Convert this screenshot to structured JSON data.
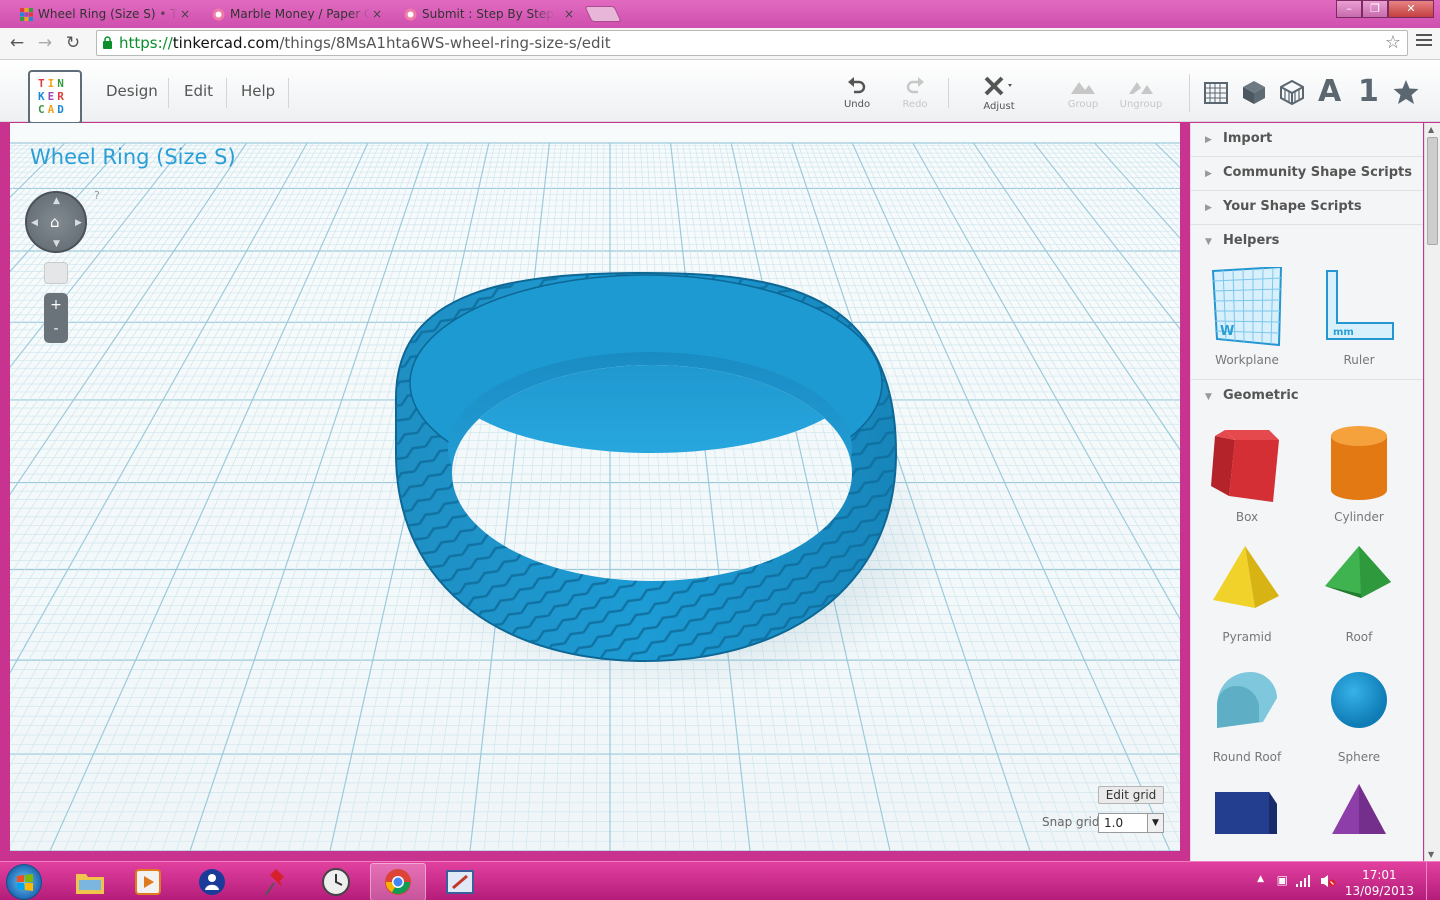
{
  "browser": {
    "tabs": [
      {
        "title": "Wheel Ring (Size S) • Tinkercad",
        "close": "×",
        "active": true
      },
      {
        "title": "Marble Money / Paper Clip",
        "close": "×",
        "active": false
      },
      {
        "title": "Submit : Step By Step",
        "close": "×",
        "active": false
      }
    ],
    "url": {
      "protocol": "https://",
      "host": "tinkercad.com",
      "path": "/things/8MsA1hta6WS-wheel-ring-size-s/edit"
    }
  },
  "header": {
    "logo_rows": [
      [
        "T",
        "I",
        "N"
      ],
      [
        "K",
        "E",
        "R"
      ],
      [
        "C",
        "A",
        "D"
      ]
    ],
    "menu": [
      "Design",
      "Edit",
      "Help"
    ],
    "tools": {
      "undo": "Undo",
      "redo": "Redo",
      "adjust": "Adjust",
      "group": "Group",
      "ungroup": "Ungroup"
    },
    "view_text_label": "A",
    "view_number_label": "1"
  },
  "workspace": {
    "design_title": "Wheel Ring (Size S)",
    "help": "?",
    "zoom_in": "+",
    "zoom_out": "-",
    "edit_grid": "Edit grid",
    "snap_grid_label": "Snap grid",
    "snap_grid_value": "1.0"
  },
  "sidebar": {
    "sections": {
      "import": "Import",
      "community": "Community Shape Scripts",
      "your_scripts": "Your Shape Scripts",
      "helpers": "Helpers",
      "geometric": "Geometric"
    },
    "helpers": [
      "Workplane",
      "Ruler"
    ],
    "workplane_mark": "W",
    "ruler_mark": "mm",
    "geometric": [
      "Box",
      "Cylinder",
      "Pyramid",
      "Roof",
      "Round Roof",
      "Sphere"
    ]
  },
  "taskbar": {
    "time": "17:01",
    "date": "13/09/2013"
  },
  "colors": {
    "accent": "#2a9ed6",
    "ring": "#1c96cf",
    "taskbar": "#c8338f"
  }
}
